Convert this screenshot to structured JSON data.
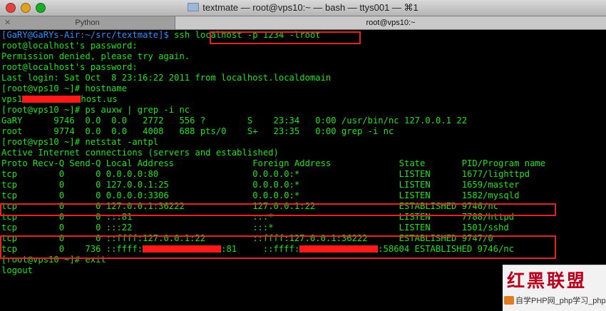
{
  "window": {
    "title": "textmate — root@vps10:~ — bash — ttys001 — ⌘1",
    "tabs": [
      {
        "label": "Python"
      },
      {
        "label": "root@vps10:~"
      }
    ]
  },
  "terminal": {
    "lines": [
      {
        "prompt": "[GaRY@GaRYs-Air:~/src/textmate]$ ",
        "text": "ssh localhost -p 1234 -lroot"
      },
      {
        "text": "root@localhost's password:"
      },
      {
        "text": "Permission denied, please try again."
      },
      {
        "text": "root@localhost's password:"
      },
      {
        "text": "Last login: Sat Oct  8 23:16:22 2011 from localhost.localdomain"
      },
      {
        "text": "[root@vps10 ~]# hostname"
      },
      {
        "text_a": "vps1",
        "text_b": "host.us"
      },
      {
        "text": "[root@vps10 ~]# ps auxw | grep -i nc"
      },
      {
        "text": "GaRY      9746  0.0  0.0   2772   556 ?        S    23:34   0:00 /usr/bin/nc 127.0.0.1 22"
      },
      {
        "text": "root      9774  0.0  0.0   4008   688 pts/0    S+   23:35   0:00 grep -i nc"
      },
      {
        "text": "[root@vps10 ~]# netstat -antpl"
      },
      {
        "text": "Active Internet connections (servers and established)"
      },
      {
        "text": "Proto Recv-Q Send-Q Local Address               Foreign Address             State       PID/Program name"
      },
      {
        "text": "tcp        0      0 0.0.0.0:80                  0.0.0.0:*                   LISTEN      1677/lighttpd"
      },
      {
        "text": "tcp        0      0 127.0.0.1:25                0.0.0.0:*                   LISTEN      1659/master"
      },
      {
        "text": "tcp        0      0 0.0.0.0:3306                0.0.0.0:*                   LISTEN      1582/mysqld"
      },
      {
        "text": "tcp        0      0 127.0.0.1:36222             127.0.0.1:22                ESTABLISHED 9746/nc"
      },
      {
        "text": "tcp        0      0 :::81                       :::*                        LISTEN      7788/httpd"
      },
      {
        "text": "tcp        0      0 :::22                       :::*                        LISTEN      1501/sshd"
      },
      {
        "text": "tcp        0      0 ::ffff:127.0.0.1:22         ::ffff:127.0.0.1:36222      ESTABLISHED 9747/0"
      },
      {
        "text_a": "tcp        0    736 ::ffff:",
        "text_b": ":81     ::ffff:",
        "text_c": ":58604 ESTABLISHED 9746/nc"
      },
      {
        "text": "[root@vps10 ~]# exit"
      },
      {
        "text": "logout"
      }
    ]
  },
  "watermark": {
    "title": "红黑联盟",
    "subtitle": "自学PHP网_php学习_php教"
  }
}
